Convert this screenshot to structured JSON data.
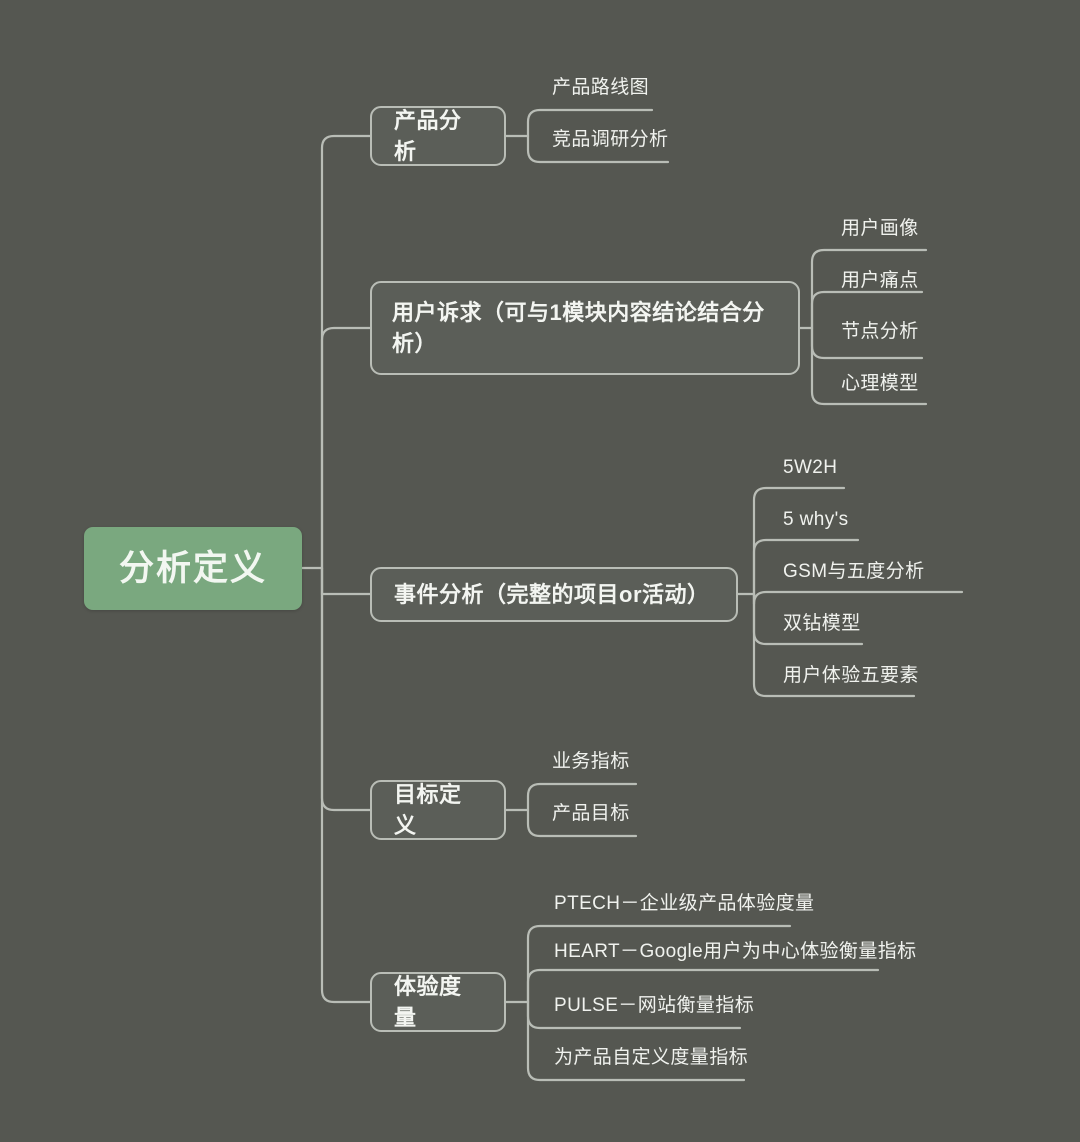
{
  "diagram": {
    "type": "mindmap",
    "title": "分析定义",
    "background_color": "#555751",
    "root_color": "#7aa87f",
    "line_color": "#b9bdb6",
    "text_color": "#f1f3ef"
  },
  "root": {
    "label": "分析定义"
  },
  "branches": [
    {
      "label": "产品分析",
      "children": [
        {
          "label": "产品路线图"
        },
        {
          "label": "竞品调研分析"
        }
      ]
    },
    {
      "label": "用户诉求（可与1模块内容结论结合分析）",
      "children": [
        {
          "label": "用户画像"
        },
        {
          "label": "用户痛点"
        },
        {
          "label": "节点分析"
        },
        {
          "label": "心理模型"
        }
      ]
    },
    {
      "label": "事件分析（完整的项目or活动）",
      "children": [
        {
          "label": "5W2H"
        },
        {
          "label": "5 why's"
        },
        {
          "label": "GSM与五度分析"
        },
        {
          "label": "双钻模型"
        },
        {
          "label": "用户体验五要素"
        }
      ]
    },
    {
      "label": "目标定义",
      "children": [
        {
          "label": "业务指标"
        },
        {
          "label": "产品目标"
        }
      ]
    },
    {
      "label": "体验度量",
      "children": [
        {
          "label": "PTECH－企业级产品体验度量"
        },
        {
          "label": "HEART－Google用户为中心体验衡量指标"
        },
        {
          "label": "PULSE－网站衡量指标"
        },
        {
          "label": "为产品自定义度量指标"
        }
      ]
    }
  ]
}
